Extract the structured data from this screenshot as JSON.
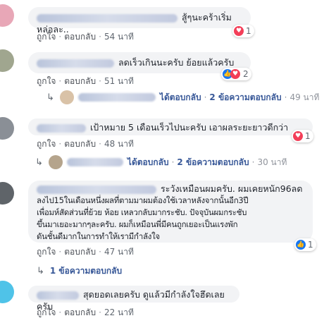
{
  "comments": [
    {
      "text": "สู้ๆนะคร้าเริ่มหล่อละ..",
      "like": "ถูกใจ",
      "reply": "ตอบกลับ",
      "time": "54 นาที",
      "reactions": "1"
    },
    {
      "text": "ลดเร็วเกินนะครับ ย้อยแล้วครับ",
      "like": "ถูกใจ",
      "reply": "ตอบกลับ",
      "time": "51 นาที",
      "reactions": "2"
    },
    {
      "text": "เป้าหมาย 5 เดือนเร็วไปนะครับ เอาผลระยะยาวดีกว่า",
      "like": "ถูกใจ",
      "reply": "ตอบกลับ",
      "time": "48 นาที",
      "reactions": "1"
    },
    {
      "text_lines": [
        "ระวังเหมือนผมครับ. ผมเคยหนัก96ลด",
        "ลงไป15ในเดือนหนึ่งผลที่ตามมาผมต้องใช้เวลาหลังจากนั้นอีก3ปี",
        "เพื่อมห์สัดส่วนที่ย้วย ห้อย เหลวกลับมากระชับ. ปัจจุบันผมกระชับ",
        "ขึ้นมาเยอะมากๆละครับ. ผมก็เหมือนพี่มีคนถูกเยอะเป็นแรงพัก",
        "ดันชั้นดีมากในการทำให้เรามีกำลังใจ"
      ],
      "like": "ถูกใจ",
      "reply": "ตอบกลับ",
      "time": "47 นาที",
      "reactions": "1"
    },
    {
      "text": "สุดยอดเลยครับ ดูแล้วมีกำลังใจฮึดเลยครับ",
      "like": "ถูกใจ",
      "reply": "ตอบกลับ",
      "time": "22 นาที"
    }
  ],
  "reply_summaries": [
    {
      "replied": "ได้ตอบกลับ",
      "count": "2 ข้อความตอบกลับ",
      "time": "49 นาที"
    },
    {
      "replied": "ได้ตอบกลับ",
      "count": "2 ข้อความตอบกลับ",
      "time": "30 นาที"
    },
    {
      "count": "1 ข้อความตอบกลับ"
    }
  ],
  "separator": "·",
  "colors": {
    "bubble": "#f2f3f5",
    "link": "#385898",
    "heart": "#f33e58",
    "like": "#1877f2"
  }
}
